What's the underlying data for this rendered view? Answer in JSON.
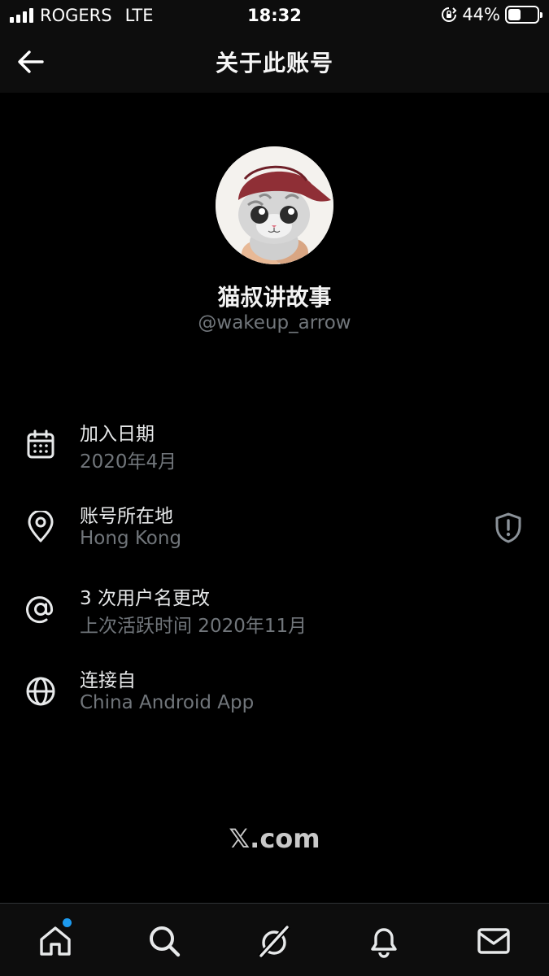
{
  "status_bar": {
    "carrier": "ROGERS",
    "network": "LTE",
    "time": "18:32",
    "battery": "44%",
    "battery_level": 0.44
  },
  "header": {
    "title": "关于此账号"
  },
  "profile": {
    "display_name": "猫叔讲故事",
    "handle": "@wakeup_arrow"
  },
  "info": [
    {
      "icon": "calendar-icon",
      "title": "加入日期",
      "value": "2020年4月"
    },
    {
      "icon": "location-pin-icon",
      "title": "账号所在地",
      "value": "Hong Kong",
      "badge_icon": "shield-alert-icon"
    },
    {
      "icon": "at-sign-icon",
      "title": "3 次用户名更改",
      "value": "上次活跃时间 2020年11月"
    },
    {
      "icon": "globe-icon",
      "title": "连接自",
      "value": "China Android App"
    }
  ],
  "footer": {
    "brand": "𝕏.com"
  },
  "bottom_nav": {
    "items": [
      "home-icon",
      "search-icon",
      "grok-icon",
      "notifications-bell-icon",
      "messages-envelope-icon"
    ],
    "home_has_notification": true,
    "accent_color": "#1d9bf0"
  }
}
